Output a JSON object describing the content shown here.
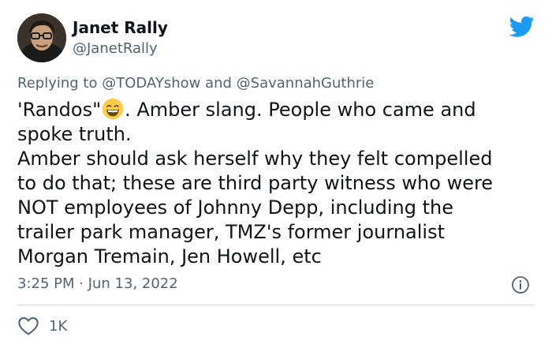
{
  "author": {
    "name": "Janet Rally",
    "handle": "@JanetRally"
  },
  "reply": {
    "prefix": "Replying to ",
    "mention1": "@TODAYshow",
    "joiner": " and ",
    "mention2": "@SavannahGuthrie"
  },
  "tweet": {
    "text_before_emoji": "'Randos\"",
    "emoji": "grinning-face-emoji",
    "text_after_emoji": ". Amber slang. People who came and\nspoke truth.\nAmber should ask herself why they felt compelled\nto do that; these are third party witness who were\nNOT employees of Johnny Depp, including the\ntrailer park manager, TMZ's former journalist\nMorgan Tremain, Jen Howell, etc"
  },
  "meta": {
    "timestamp": "3:25 PM · Jun 13, 2022"
  },
  "engagement": {
    "likes": "1K"
  },
  "colors": {
    "twitter_blue": "#1d9bf0",
    "secondary_text": "#536471",
    "primary_text": "#0f1419"
  },
  "icons": [
    "twitter-bird-icon",
    "info-icon",
    "heart-icon"
  ]
}
